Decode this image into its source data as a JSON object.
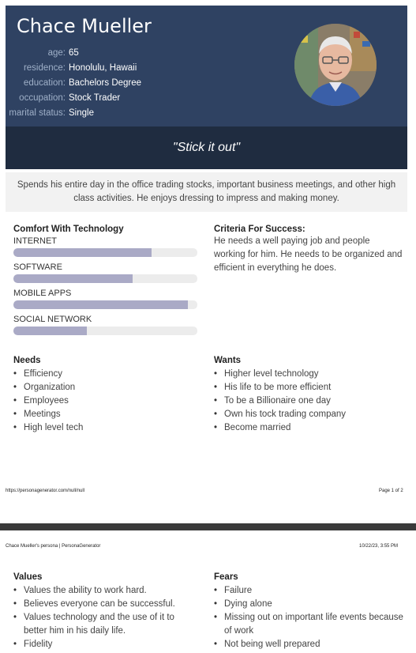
{
  "persona": {
    "name": "Chace Mueller",
    "info": [
      {
        "label": "age:",
        "value": "65"
      },
      {
        "label": "residence:",
        "value": "Honolulu, Hawaii"
      },
      {
        "label": "education:",
        "value": "Bachelors Degree"
      },
      {
        "label": "occupation:",
        "value": "Stock Trader"
      },
      {
        "label": "marital status:",
        "value": "Single"
      }
    ],
    "quote": "\"Stick it out\"",
    "description": "Spends his entire day in the office trading stocks, important business meetings, and other high class activities. He enjoys dressing to impress and making money."
  },
  "comfort": {
    "title": "Comfort With Technology",
    "items": [
      {
        "label": "INTERNET",
        "level": 0.75
      },
      {
        "label": "SOFTWARE",
        "level": 0.65
      },
      {
        "label": "MOBILE APPS",
        "level": 0.95
      },
      {
        "label": "SOCIAL NETWORK",
        "level": 0.4
      }
    ]
  },
  "criteria": {
    "title": "Criteria For Success:",
    "text": "He needs a well paying job and people working for him. He needs to be organized and efficient in everything he does."
  },
  "needs": {
    "title": "Needs",
    "items": [
      "Efficiency",
      "Organization",
      "Employees",
      "Meetings",
      "High level tech"
    ]
  },
  "wants": {
    "title": "Wants",
    "items": [
      "Higher level technology",
      "His life to be more efficient",
      "To be a Billionaire one day",
      "Own his tock trading company",
      "Become married"
    ]
  },
  "footer": {
    "url": "https://personagenerator.com/null/null",
    "page": "Page 1 of 2"
  },
  "page2_header": {
    "title": "Chace Mueller's persona | PersonaGenerator",
    "datetime": "10/22/23, 3:55 PM"
  },
  "values": {
    "title": "Values",
    "items": [
      "Values the ability to work hard.",
      "Believes everyone can be successful.",
      "Values technology and the use of it to better him in his daily life.",
      "Fidelity"
    ]
  },
  "fears": {
    "title": "Fears",
    "items": [
      "Failure",
      "Dying alone",
      "Missing out on important life events because of work",
      "Not being well prepared"
    ]
  },
  "colors": {
    "header_bg": "#2f4262",
    "quote_bg": "#1f2c40",
    "bar_fill": "#aaaac6",
    "bar_track": "#ececec"
  }
}
